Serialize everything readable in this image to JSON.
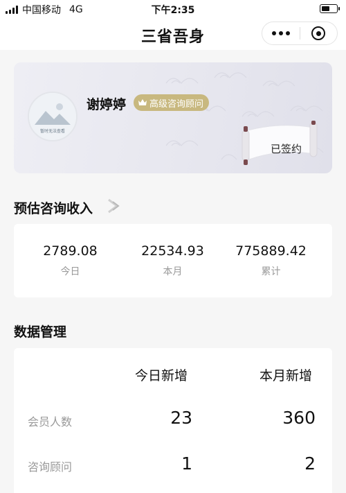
{
  "status_bar": {
    "carrier": "中国移动",
    "network": "4G",
    "time": "下午2:35"
  },
  "nav": {
    "title": "三省吾身",
    "icons": [
      "more-icon",
      "close-mini-program-icon"
    ]
  },
  "profile": {
    "name": "谢婷婷",
    "badge": "高级咨询顾问",
    "avatar_text": "暂时无法查看",
    "status": "已签约"
  },
  "income": {
    "title": "预估咨询收入",
    "items": [
      {
        "value": "2789.08",
        "label": "今日"
      },
      {
        "value": "22534.93",
        "label": "本月"
      },
      {
        "value": "775889.42",
        "label": "累计"
      }
    ]
  },
  "data_management": {
    "title": "数据管理",
    "columns": [
      "今日新增",
      "本月新增"
    ],
    "rows": [
      {
        "label": "会员人数",
        "today": "23",
        "month": "360"
      },
      {
        "label": "咨询顾问",
        "today": "1",
        "month": "2"
      }
    ]
  },
  "colors": {
    "badge": "#c8b87f",
    "card_bg": "#ffffff",
    "page_bg": "#f6f6f6",
    "muted_text": "#999999"
  }
}
